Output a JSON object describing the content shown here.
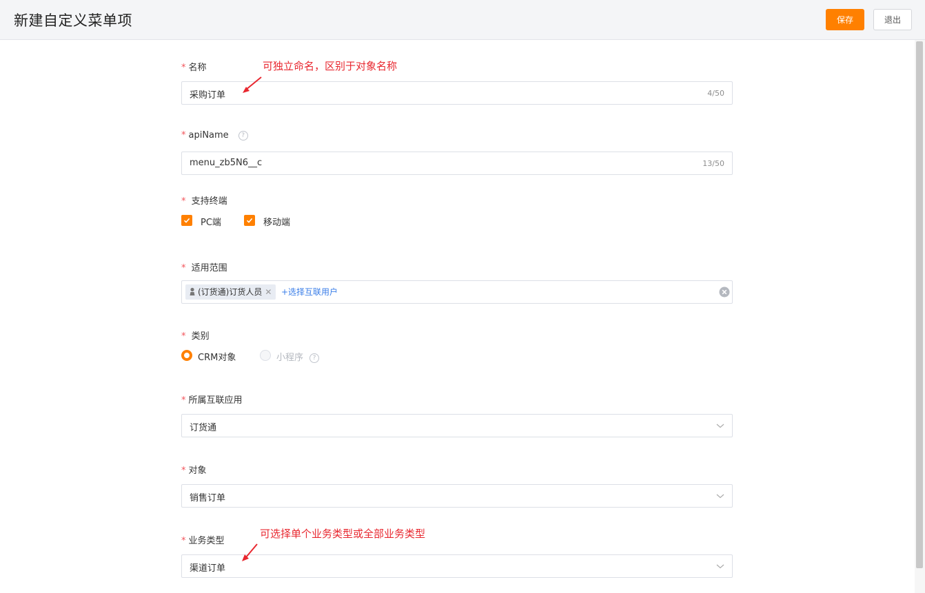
{
  "header": {
    "title": "新建自定义菜单项",
    "save_label": "保存",
    "exit_label": "退出"
  },
  "form": {
    "name": {
      "label": "名称",
      "value": "采购订单",
      "count": "4/50"
    },
    "api_name": {
      "label": "apiName",
      "value": "menu_zb5N6__c",
      "count": "13/50"
    },
    "terminals": {
      "label": "支持终端",
      "options": [
        "PC端",
        "移动端"
      ]
    },
    "scope": {
      "label": "适用范围",
      "tag": "(订货通)订货人员",
      "add_link": "+选择互联用户"
    },
    "category": {
      "label": "类别",
      "options": [
        "CRM对象",
        "小程序"
      ]
    },
    "app": {
      "label": "所属互联应用",
      "value": "订货通"
    },
    "object": {
      "label": "对象",
      "value": "销售订单"
    },
    "business_type": {
      "label": "业务类型",
      "value": "渠道订单"
    }
  },
  "annotations": {
    "name_note": "可独立命名，区别于对象名称",
    "business_note": "可选择单个业务类型或全部业务类型"
  },
  "colors": {
    "accent": "#ff8000",
    "link": "#3a7ee8",
    "annotation": "#e8272f",
    "required": "#f2545b"
  }
}
